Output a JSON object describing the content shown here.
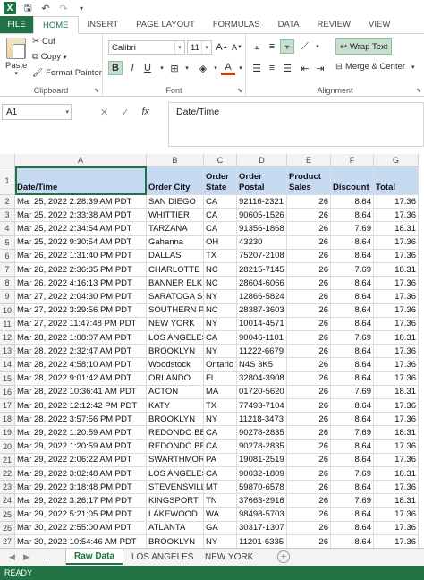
{
  "titlebar": {
    "logo": "X",
    "qat": [
      "save-icon",
      "undo-icon",
      "redo-icon",
      "customize-icon"
    ]
  },
  "ribbon_tabs": [
    "FILE",
    "HOME",
    "INSERT",
    "PAGE LAYOUT",
    "FORMULAS",
    "DATA",
    "REVIEW",
    "VIEW"
  ],
  "clipboard": {
    "paste": "Paste",
    "cut": "Cut",
    "copy": "Copy",
    "format_painter": "Format Painter",
    "label": "Clipboard"
  },
  "font": {
    "name": "Calibri",
    "size": "11",
    "bold": "B",
    "italic": "I",
    "underline": "U",
    "grow": "A",
    "shrink": "A",
    "font_color_letter": "A",
    "label": "Font",
    "font_color": "#d83b01"
  },
  "alignment": {
    "wrap_text": "Wrap Text",
    "merge_center": "Merge & Center",
    "label": "Alignment"
  },
  "formula_bar": {
    "cell_ref": "A1",
    "cancel": "✕",
    "enter": "✓",
    "fx": "fx",
    "content": "Date/Time"
  },
  "grid": {
    "columns": [
      "A",
      "B",
      "C",
      "D",
      "E",
      "F",
      "G"
    ],
    "headers": [
      "Date/Time",
      "Order City",
      "Order State",
      "Order Postal",
      "Product Sales",
      "Discount",
      "Total"
    ],
    "rows": [
      [
        "2",
        "Mar 25, 2022 2:28:39 AM PDT",
        "SAN DIEGO",
        "CA",
        "92116-2321",
        "26",
        "8.64",
        "17.36"
      ],
      [
        "3",
        "Mar 25, 2022 2:33:38 AM PDT",
        "WHITTIER",
        "CA",
        "90605-1526",
        "26",
        "8.64",
        "17.36"
      ],
      [
        "4",
        "Mar 25, 2022 2:34:54 AM PDT",
        "TARZANA",
        "CA",
        "91356-1868",
        "26",
        "7.69",
        "18.31"
      ],
      [
        "5",
        "Mar 25, 2022 9:30:54 AM PDT",
        "Gahanna",
        "OH",
        "43230",
        "26",
        "8.64",
        "17.36"
      ],
      [
        "6",
        "Mar 26, 2022 1:31:40 PM PDT",
        "DALLAS",
        "TX",
        "75207-2108",
        "26",
        "8.64",
        "17.36"
      ],
      [
        "7",
        "Mar 26, 2022 2:36:35 PM PDT",
        "CHARLOTTE",
        "NC",
        "28215-7145",
        "26",
        "7.69",
        "18.31"
      ],
      [
        "8",
        "Mar 26, 2022 4:16:13 PM PDT",
        "BANNER ELK",
        "NC",
        "28604-6066",
        "26",
        "8.64",
        "17.36"
      ],
      [
        "9",
        "Mar 27, 2022 2:04:30 PM PDT",
        "SARATOGA SP",
        "NY",
        "12866-5824",
        "26",
        "8.64",
        "17.36"
      ],
      [
        "10",
        "Mar 27, 2022 3:29:56 PM PDT",
        "SOUTHERN PI",
        "NC",
        "28387-3603",
        "26",
        "8.64",
        "17.36"
      ],
      [
        "11",
        "Mar 27, 2022 11:47:48 PM PDT",
        "NEW YORK",
        "NY",
        "10014-4571",
        "26",
        "8.64",
        "17.36"
      ],
      [
        "12",
        "Mar 28, 2022 1:08:07 AM PDT",
        "LOS ANGELES",
        "CA",
        "90046-1101",
        "26",
        "7.69",
        "18.31"
      ],
      [
        "13",
        "Mar 28, 2022 2:32:47 AM PDT",
        "BROOKLYN",
        "NY",
        "11222-6679",
        "26",
        "8.64",
        "17.36"
      ],
      [
        "14",
        "Mar 28, 2022 4:58:10 AM PDT",
        "Woodstock",
        "Ontario",
        "N4S 3K5",
        "26",
        "8.64",
        "17.36"
      ],
      [
        "15",
        "Mar 28, 2022 9:01:42 AM PDT",
        "ORLANDO",
        "FL",
        "32804-3908",
        "26",
        "8.64",
        "17.36"
      ],
      [
        "16",
        "Mar 28, 2022 10:36:41 AM PDT",
        "ACTON",
        "MA",
        "01720-5620",
        "26",
        "7.69",
        "18.31"
      ],
      [
        "17",
        "Mar 28, 2022 12:12:42 PM PDT",
        "KATY",
        "TX",
        "77493-7104",
        "26",
        "8.64",
        "17.36"
      ],
      [
        "18",
        "Mar 28, 2022 3:57:56 PM PDT",
        "BROOKLYN",
        "NY",
        "11218-3473",
        "26",
        "8.64",
        "17.36"
      ],
      [
        "19",
        "Mar 29, 2022 1:20:59 AM PDT",
        "REDONDO BE",
        "CA",
        "90278-2835",
        "26",
        "7.69",
        "18.31"
      ],
      [
        "20",
        "Mar 29, 2022 1:20:59 AM PDT",
        "REDONDO BE",
        "CA",
        "90278-2835",
        "26",
        "8.64",
        "17.36"
      ],
      [
        "21",
        "Mar 29, 2022 2:06:22 AM PDT",
        "SWARTHMOR",
        "PA",
        "19081-2519",
        "26",
        "8.64",
        "17.36"
      ],
      [
        "22",
        "Mar 29, 2022 3:02:48 AM PDT",
        "LOS ANGELES",
        "CA",
        "90032-1809",
        "26",
        "7.69",
        "18.31"
      ],
      [
        "23",
        "Mar 29, 2022 3:18:48 PM PDT",
        "STEVENSVILL",
        "MT",
        "59870-6578",
        "26",
        "8.64",
        "17.36"
      ],
      [
        "24",
        "Mar 29, 2022 3:26:17 PM PDT",
        "KINGSPORT",
        "TN",
        "37663-2916",
        "26",
        "7.69",
        "18.31"
      ],
      [
        "25",
        "Mar 29, 2022 5:21:05 PM PDT",
        "LAKEWOOD",
        "WA",
        "98498-5703",
        "26",
        "8.64",
        "17.36"
      ],
      [
        "26",
        "Mar 30, 2022 2:55:00 AM PDT",
        "ATLANTA",
        "GA",
        "30317-1307",
        "26",
        "8.64",
        "17.36"
      ],
      [
        "27",
        "Mar 30, 2022 10:54:46 AM PDT",
        "BROOKLYN",
        "NY",
        "11201-6335",
        "26",
        "8.64",
        "17.36"
      ]
    ],
    "header_color": "#c5d9f1"
  },
  "sheets": [
    "Raw Data",
    "LOS ANGELES",
    "NEW YORK"
  ],
  "status": "READY",
  "colors": {
    "accent": "#217346"
  }
}
